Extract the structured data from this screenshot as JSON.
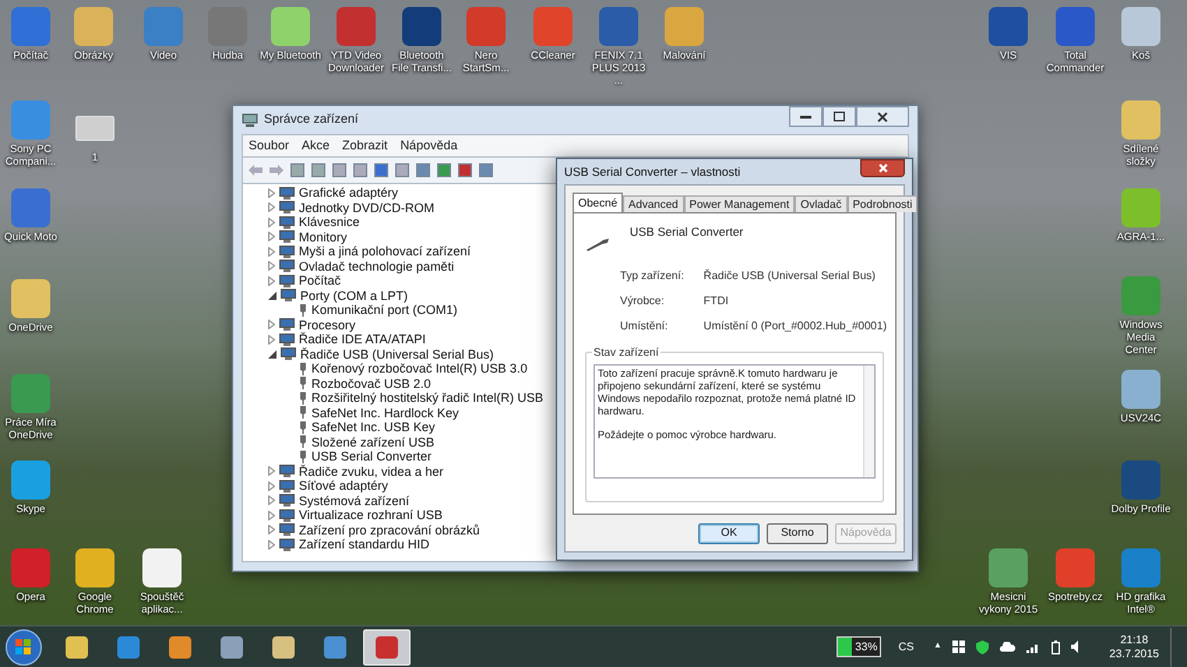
{
  "desktop_icons": [
    {
      "label": "Počítač"
    },
    {
      "label": "Obrázky"
    },
    {
      "label": "Video"
    },
    {
      "label": "Hudba"
    },
    {
      "label": "My Bluetooth"
    },
    {
      "label": "YTD Video Downloader"
    },
    {
      "label": "Bluetooth File Transfi..."
    },
    {
      "label": "Nero StartSm..."
    },
    {
      "label": "CCleaner"
    },
    {
      "label": "FENIX 7.1 PLUS 2013 ..."
    },
    {
      "label": "Malování"
    },
    {
      "label": "VIS"
    },
    {
      "label": "Total Commander"
    },
    {
      "label": "Koš"
    },
    {
      "label": "Sony PC Compani..."
    },
    {
      "label": "1"
    },
    {
      "label": "Quick Moto"
    },
    {
      "label": "OneDrive"
    },
    {
      "label": "Práce Míra OneDrive"
    },
    {
      "label": "Skype"
    },
    {
      "label": "Sdílené složky"
    },
    {
      "label": "AGRA-1..."
    },
    {
      "label": "Windows Media Center"
    },
    {
      "label": "USV24C"
    },
    {
      "label": "Dolby Profile"
    },
    {
      "label": "Opera"
    },
    {
      "label": "Google Chrome"
    },
    {
      "label": "Spouštěč aplikac..."
    },
    {
      "label": "Mesicni vykony 2015"
    },
    {
      "label": "Spotreby.cz"
    },
    {
      "label": "HD grafika Intel®"
    }
  ],
  "device_manager": {
    "title": "Správce zařízení",
    "menu": [
      "Soubor",
      "Akce",
      "Zobrazit",
      "Nápověda"
    ],
    "tree": [
      {
        "label": "Grafické adaptéry",
        "expanded": false
      },
      {
        "label": "Jednotky DVD/CD-ROM",
        "expanded": false
      },
      {
        "label": "Klávesnice",
        "expanded": false
      },
      {
        "label": "Monitory",
        "expanded": false
      },
      {
        "label": "Myši a jiná polohovací zařízení",
        "expanded": false
      },
      {
        "label": "Ovladač technologie paměti",
        "expanded": false
      },
      {
        "label": "Počítač",
        "expanded": false
      },
      {
        "label": "Porty (COM a LPT)",
        "expanded": true,
        "children": [
          {
            "label": "Komunikační port (COM1)"
          }
        ]
      },
      {
        "label": "Procesory",
        "expanded": false
      },
      {
        "label": "Řadiče IDE ATA/ATAPI",
        "expanded": false
      },
      {
        "label": "Řadiče USB (Universal Serial Bus)",
        "expanded": true,
        "children": [
          {
            "label": "Kořenový rozbočovač Intel(R) USB 3.0"
          },
          {
            "label": "Rozbočovač USB 2.0"
          },
          {
            "label": "Rozšiřitelný hostitelský řadič Intel(R) USB"
          },
          {
            "label": "SafeNet Inc. Hardlock Key"
          },
          {
            "label": "SafeNet Inc. USB Key"
          },
          {
            "label": "Složené zařízení USB"
          },
          {
            "label": "USB Serial Converter"
          }
        ]
      },
      {
        "label": "Řadiče zvuku, videa a her",
        "expanded": false
      },
      {
        "label": "Síťové adaptéry",
        "expanded": false
      },
      {
        "label": "Systémová zařízení",
        "expanded": false
      },
      {
        "label": "Virtualizace rozhraní USB",
        "expanded": false
      },
      {
        "label": "Zařízení pro zpracování obrázků",
        "expanded": false
      },
      {
        "label": "Zařízení standardu HID",
        "expanded": false
      }
    ]
  },
  "dialog": {
    "title": "USB Serial Converter – vlastnosti",
    "tabs": [
      {
        "label": "Obecné",
        "selected": true
      },
      {
        "label": "Advanced",
        "selected": false
      },
      {
        "label": "Power Management",
        "selected": false
      },
      {
        "label": "Ovladač",
        "selected": false
      },
      {
        "label": "Podrobnosti",
        "selected": false
      }
    ],
    "device_name": "USB Serial Converter",
    "properties": [
      {
        "label": "Typ zařízení:",
        "value": "Řadiče USB (Universal Serial Bus)"
      },
      {
        "label": "Výrobce:",
        "value": "FTDI"
      },
      {
        "label": "Umístění:",
        "value": "Umístění 0 (Port_#0002.Hub_#0001)"
      }
    ],
    "status_group": "Stav zařízení",
    "status_text": [
      "Toto zařízení pracuje správně.K tomuto hardwaru je připojeno sekundární zařízení, které se systému Windows nepodařilo rozpoznat, protože nemá platné ID hardwaru.",
      "Požádejte o pomoc výrobce hardwaru."
    ],
    "buttons": [
      {
        "label": "OK",
        "disabled": false,
        "default": true
      },
      {
        "label": "Storno",
        "disabled": false,
        "default": false
      },
      {
        "label": "Nápověda",
        "disabled": true,
        "default": false
      }
    ]
  },
  "taskbar": {
    "apps": [
      {
        "selected": false
      },
      {
        "selected": false
      },
      {
        "selected": false
      },
      {
        "selected": false
      },
      {
        "selected": false
      },
      {
        "selected": false
      },
      {
        "selected": true
      }
    ],
    "battery": {
      "text": "33%",
      "level": 0.33
    },
    "language": "CS",
    "show_hidden": "▲",
    "time": "21:18",
    "date": "23.7.2015"
  }
}
